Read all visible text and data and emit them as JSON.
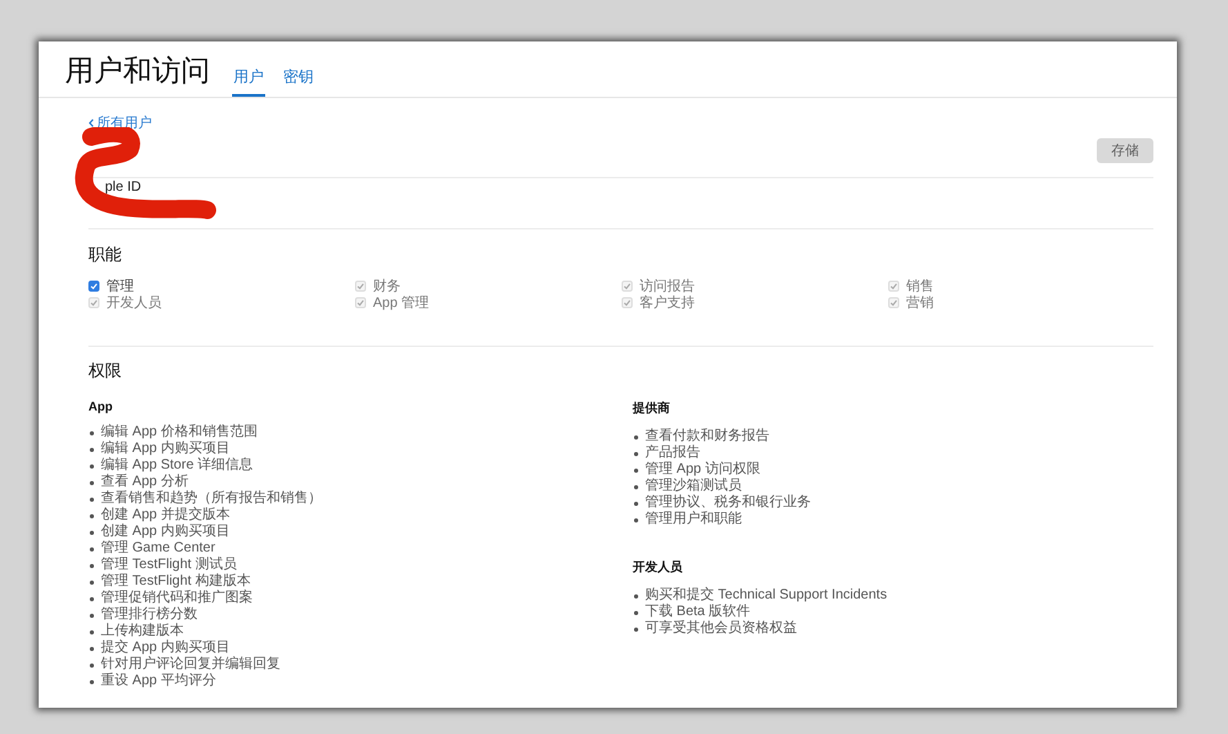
{
  "header": {
    "title": "用户和访问",
    "tabs": [
      {
        "label": "用户",
        "selected": true
      },
      {
        "label": "密钥",
        "selected": false
      }
    ]
  },
  "back_link": "所有用户",
  "save_button": {
    "label": "存储",
    "disabled": true
  },
  "account": {
    "apple_id_label": "ple ID"
  },
  "roles": {
    "heading": "职能",
    "items": [
      {
        "label": "管理",
        "checked": true,
        "disabled": false
      },
      {
        "label": "财务",
        "checked": true,
        "disabled": true
      },
      {
        "label": "访问报告",
        "checked": true,
        "disabled": true
      },
      {
        "label": "销售",
        "checked": true,
        "disabled": true
      },
      {
        "label": "开发人员",
        "checked": true,
        "disabled": true
      },
      {
        "label": "App 管理",
        "checked": true,
        "disabled": true
      },
      {
        "label": "客户支持",
        "checked": true,
        "disabled": true
      },
      {
        "label": "营销",
        "checked": true,
        "disabled": true
      }
    ]
  },
  "permissions": {
    "heading": "权限",
    "groups": [
      {
        "title": "App",
        "items": [
          "编辑 App 价格和销售范围",
          "编辑 App 内购买项目",
          "编辑 App Store 详细信息",
          "查看 App 分析",
          "查看销售和趋势（所有报告和销售）",
          "创建 App 并提交版本",
          "创建 App 内购买项目",
          "管理 Game Center",
          "管理 TestFlight 测试员",
          "管理 TestFlight 构建版本",
          "管理促销代码和推广图案",
          "管理排行榜分数",
          "上传构建版本",
          "提交 App 内购买项目",
          "针对用户评论回复并编辑回复",
          "重设 App 平均评分"
        ]
      },
      {
        "title": "提供商",
        "items": [
          "查看付款和财务报告",
          "产品报告",
          "管理 App 访问权限",
          "管理沙箱测试员",
          "管理协议、税务和银行业务",
          "管理用户和职能"
        ]
      },
      {
        "title": "开发人员",
        "items": [
          "购买和提交 Technical Support Incidents",
          "下载 Beta 版软件",
          "可享受其他会员资格权益"
        ]
      }
    ]
  }
}
